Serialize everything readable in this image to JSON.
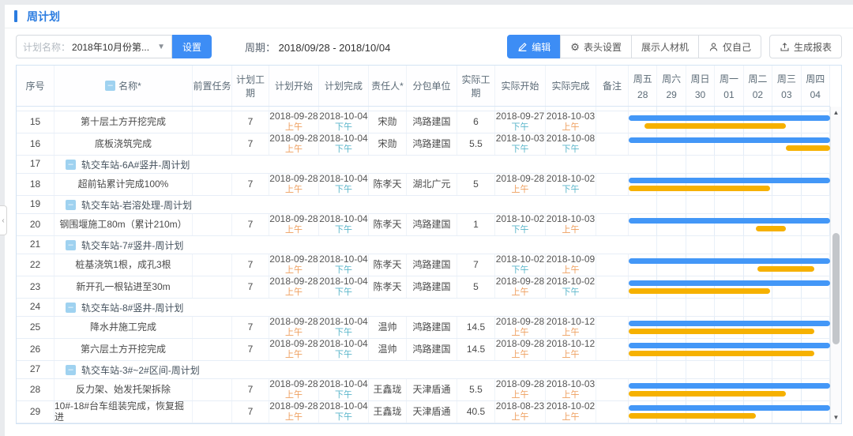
{
  "page": {
    "title": "周计划"
  },
  "toolbar": {
    "plan_label": "计划名称：",
    "plan_value": "2018年10月份第...",
    "settings_button": "设置",
    "period_label": "周期：",
    "period_value": "2018/09/28 - 2018/10/04",
    "edit_button": "编辑",
    "header_settings_button": "表头设置",
    "show_resources_button": "展示人材机",
    "only_me_button": "仅自己",
    "report_button": "生成报表"
  },
  "colors": {
    "accent_blue": "#2b7ce0",
    "button_blue": "#3d8df5",
    "plan_bar": "#4397f7",
    "actual_bar": "#f6b100",
    "am_text": "#ef9f5f",
    "pm_text": "#5bb6cb"
  },
  "table": {
    "columns": [
      "序号",
      "名称*",
      "前置任务",
      "计划工期",
      "计划开始",
      "计划完成",
      "责任人*",
      "分包单位",
      "实际工期",
      "实际开始",
      "实际完成",
      "备注"
    ],
    "gantt_days": [
      {
        "week": "周五",
        "day": "28"
      },
      {
        "week": "周六",
        "day": "29"
      },
      {
        "week": "周日",
        "day": "30"
      },
      {
        "week": "周一",
        "day": "01"
      },
      {
        "week": "周二",
        "day": "02"
      },
      {
        "week": "周三",
        "day": "03"
      },
      {
        "week": "周四",
        "day": "04"
      }
    ],
    "rows": [
      {
        "no": "15",
        "type": "task",
        "name": "第十层土方开挖完成",
        "pre_task": "",
        "plan_duration": "7",
        "plan_start": "2018-09-28",
        "plan_start_period": "上午",
        "plan_finish": "2018-10-04",
        "plan_finish_period": "下午",
        "owner": "宋勋",
        "subcontractor": "鸿路建国",
        "actual_duration": "6",
        "actual_start": "2018-09-27",
        "actual_start_period": "下午",
        "actual_finish": "2018-10-03",
        "actual_finish_period": "上午",
        "note": "",
        "bars": {
          "plan": [
            0,
            100
          ],
          "actual": [
            8,
            78
          ]
        }
      },
      {
        "no": "16",
        "type": "task",
        "name": "底板浇筑完成",
        "pre_task": "",
        "plan_duration": "7",
        "plan_start": "2018-09-28",
        "plan_start_period": "上午",
        "plan_finish": "2018-10-04",
        "plan_finish_period": "下午",
        "owner": "宋勋",
        "subcontractor": "鸿路建国",
        "actual_duration": "5.5",
        "actual_start": "2018-10-03",
        "actual_start_period": "下午",
        "actual_finish": "2018-10-08",
        "actual_finish_period": "下午",
        "note": "",
        "bars": {
          "plan": [
            0,
            100
          ],
          "actual": [
            78,
            100
          ]
        }
      },
      {
        "no": "17",
        "type": "group",
        "name": "轨交车站-6A#竖井-周计划"
      },
      {
        "no": "18",
        "type": "task",
        "name": "超前钻累计完成100%",
        "pre_task": "",
        "plan_duration": "7",
        "plan_start": "2018-09-28",
        "plan_start_period": "上午",
        "plan_finish": "2018-10-04",
        "plan_finish_period": "下午",
        "owner": "陈孝天",
        "subcontractor": "湖北广元",
        "actual_duration": "5",
        "actual_start": "2018-09-28",
        "actual_start_period": "上午",
        "actual_finish": "2018-10-02",
        "actual_finish_period": "下午",
        "note": "",
        "bars": {
          "plan": [
            0,
            100
          ],
          "actual": [
            0,
            70
          ]
        }
      },
      {
        "no": "19",
        "type": "group",
        "name": "轨交车站-岩溶处理-周计划"
      },
      {
        "no": "20",
        "type": "task",
        "name": "钢围堰施工80m（累计210m）",
        "pre_task": "",
        "plan_duration": "7",
        "plan_start": "2018-09-28",
        "plan_start_period": "上午",
        "plan_finish": "2018-10-04",
        "plan_finish_period": "下午",
        "owner": "陈孝天",
        "subcontractor": "鸿路建国",
        "actual_duration": "1",
        "actual_start": "2018-10-02",
        "actual_start_period": "下午",
        "actual_finish": "2018-10-03",
        "actual_finish_period": "上午",
        "note": "",
        "bars": {
          "plan": [
            0,
            100
          ],
          "actual": [
            63,
            78
          ]
        }
      },
      {
        "no": "21",
        "type": "group",
        "name": "轨交车站-7#竖井-周计划"
      },
      {
        "no": "22",
        "type": "task",
        "name": "桩基浇筑1根，成孔3根",
        "pre_task": "",
        "plan_duration": "7",
        "plan_start": "2018-09-28",
        "plan_start_period": "上午",
        "plan_finish": "2018-10-04",
        "plan_finish_period": "下午",
        "owner": "陈孝天",
        "subcontractor": "鸿路建国",
        "actual_duration": "7",
        "actual_start": "2018-10-02",
        "actual_start_period": "下午",
        "actual_finish": "2018-10-09",
        "actual_finish_period": "上午",
        "note": "",
        "bars": {
          "plan": [
            0,
            100
          ],
          "actual": [
            64,
            92
          ]
        }
      },
      {
        "no": "23",
        "type": "task",
        "name": "新开孔一根钻进至30m",
        "pre_task": "",
        "plan_duration": "7",
        "plan_start": "2018-09-28",
        "plan_start_period": "上午",
        "plan_finish": "2018-10-04",
        "plan_finish_period": "下午",
        "owner": "陈孝天",
        "subcontractor": "鸿路建国",
        "actual_duration": "5",
        "actual_start": "2018-09-28",
        "actual_start_period": "上午",
        "actual_finish": "2018-10-02",
        "actual_finish_period": "下午",
        "note": "",
        "bars": {
          "plan": [
            0,
            100
          ],
          "actual": [
            0,
            70
          ]
        }
      },
      {
        "no": "24",
        "type": "group",
        "name": "轨交车站-8#竖井-周计划"
      },
      {
        "no": "25",
        "type": "task",
        "name": "降水井施工完成",
        "pre_task": "",
        "plan_duration": "7",
        "plan_start": "2018-09-28",
        "plan_start_period": "上午",
        "plan_finish": "2018-10-04",
        "plan_finish_period": "下午",
        "owner": "温帅",
        "subcontractor": "鸿路建国",
        "actual_duration": "14.5",
        "actual_start": "2018-09-28",
        "actual_start_period": "上午",
        "actual_finish": "2018-10-12",
        "actual_finish_period": "上午",
        "note": "",
        "bars": {
          "plan": [
            0,
            100
          ],
          "actual": [
            0,
            92
          ]
        }
      },
      {
        "no": "26",
        "type": "task",
        "name": "第六层土方开挖完成",
        "pre_task": "",
        "plan_duration": "7",
        "plan_start": "2018-09-28",
        "plan_start_period": "上午",
        "plan_finish": "2018-10-04",
        "plan_finish_period": "下午",
        "owner": "温帅",
        "subcontractor": "鸿路建国",
        "actual_duration": "14.5",
        "actual_start": "2018-09-28",
        "actual_start_period": "上午",
        "actual_finish": "2018-10-12",
        "actual_finish_period": "上午",
        "note": "",
        "bars": {
          "plan": [
            0,
            100
          ],
          "actual": [
            0,
            92
          ]
        }
      },
      {
        "no": "27",
        "type": "group",
        "name": "轨交车站-3#~2#区间-周计划"
      },
      {
        "no": "28",
        "type": "task",
        "name": "反力架、始发托架拆除",
        "pre_task": "",
        "plan_duration": "7",
        "plan_start": "2018-09-28",
        "plan_start_period": "上午",
        "plan_finish": "2018-10-04",
        "plan_finish_period": "下午",
        "owner": "王鑫珑",
        "subcontractor": "天津盾通",
        "actual_duration": "5.5",
        "actual_start": "2018-09-28",
        "actual_start_period": "上午",
        "actual_finish": "2018-10-03",
        "actual_finish_period": "上午",
        "note": "",
        "bars": {
          "plan": [
            0,
            100
          ],
          "actual": [
            0,
            78
          ]
        }
      },
      {
        "no": "29",
        "type": "task",
        "name": "10#-18#台车组装完成，恢复掘进",
        "pre_task": "",
        "plan_duration": "7",
        "plan_start": "2018-09-28",
        "plan_start_period": "上午",
        "plan_finish": "2018-10-04",
        "plan_finish_period": "下午",
        "owner": "王鑫珑",
        "subcontractor": "天津盾通",
        "actual_duration": "40.5",
        "actual_start": "2018-08-23",
        "actual_start_period": "上午",
        "actual_finish": "2018-10-02",
        "actual_finish_period": "上午",
        "note": "",
        "bars": {
          "plan": [
            0,
            100
          ],
          "actual": [
            0,
            63
          ]
        }
      }
    ]
  }
}
